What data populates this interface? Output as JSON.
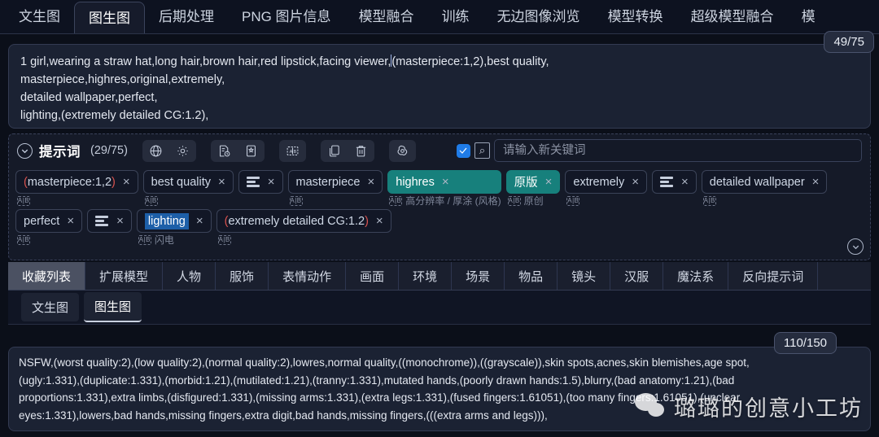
{
  "top_tabs": [
    {
      "label": "文生图",
      "active": false
    },
    {
      "label": "图生图",
      "active": true
    },
    {
      "label": "后期处理",
      "active": false
    },
    {
      "label": "PNG 图片信息",
      "active": false
    },
    {
      "label": "模型融合",
      "active": false
    },
    {
      "label": "训练",
      "active": false
    },
    {
      "label": "无边图像浏览",
      "active": false
    },
    {
      "label": "模型转换",
      "active": false
    },
    {
      "label": "超级模型融合",
      "active": false
    },
    {
      "label": "模",
      "active": false
    }
  ],
  "positive_prompt": {
    "lines": [
      "1 girl,wearing a straw hat,long hair,brown hair,red lipstick,facing viewer,(masterpiece:1,2),best quality,",
      "masterpiece,highres,original,extremely,",
      "detailed wallpaper,perfect,",
      "lighting,(extremely detailed CG:1.2),"
    ],
    "counter": "49/75"
  },
  "keyword_panel": {
    "title": "提示词",
    "count": "(29/75)",
    "toolbar_icons": [
      "globe-icon",
      "gear-icon",
      "history-document-icon",
      "bookmark-icon",
      "translate-ab-icon",
      "copy-icon",
      "trash-icon",
      "openai-spiral-icon"
    ],
    "add_keyword": {
      "checked": true,
      "placeholder": "请输入新关键词",
      "value": ""
    },
    "chips_row1": [
      {
        "text": "(masterpiece:1,2)",
        "paren": true,
        "style": "plain",
        "sub": ""
      },
      {
        "text": "best quality",
        "style": "plain",
        "sub": ""
      },
      {
        "text": "",
        "style": "sort",
        "sub": ""
      },
      {
        "text": "masterpiece",
        "style": "plain",
        "sub": ""
      },
      {
        "text": "highres",
        "style": "fill-teal",
        "sub": "高分辨率 / 厚涂 (风格)"
      },
      {
        "text": "原版",
        "style": "fill-teal",
        "sub": "原创"
      },
      {
        "text": "extremely",
        "style": "plain",
        "sub": ""
      },
      {
        "text": "",
        "style": "sort",
        "sub": ""
      },
      {
        "text": "detailed wallpaper",
        "style": "plain",
        "sub": ""
      }
    ],
    "chips_row2": [
      {
        "text": "perfect",
        "style": "plain",
        "sub": ""
      },
      {
        "text": "",
        "style": "sort",
        "sub": ""
      },
      {
        "text": "lighting",
        "style": "hl-blue",
        "sub": "闪电"
      },
      {
        "text": "(extremely detailed CG:1.2)",
        "paren": true,
        "style": "plain",
        "sub": ""
      }
    ]
  },
  "category_tabs": [
    {
      "label": "收藏列表",
      "active": true
    },
    {
      "label": "扩展模型",
      "active": false
    },
    {
      "label": "人物",
      "active": false
    },
    {
      "label": "服饰",
      "active": false
    },
    {
      "label": "表情动作",
      "active": false
    },
    {
      "label": "画面",
      "active": false
    },
    {
      "label": "环境",
      "active": false
    },
    {
      "label": "场景",
      "active": false
    },
    {
      "label": "物品",
      "active": false
    },
    {
      "label": "镜头",
      "active": false
    },
    {
      "label": "汉服",
      "active": false
    },
    {
      "label": "魔法系",
      "active": false
    },
    {
      "label": "反向提示词",
      "active": false
    }
  ],
  "sub_tabs": [
    {
      "label": "文生图",
      "active": false
    },
    {
      "label": "图生图",
      "active": true
    }
  ],
  "negative_prompt": {
    "lines": [
      "NSFW,(worst quality:2),(low quality:2),(normal quality:2),lowres,normal quality,((monochrome)),((grayscale)),skin spots,acnes,skin blemishes,age spot,",
      "(ugly:1.331),(duplicate:1.331),(morbid:1.21),(mutilated:1.21),(tranny:1.331),mutated hands,(poorly drawn hands:1.5),blurry,(bad anatomy:1.21),(bad",
      "proportions:1.331),extra limbs,(disfigured:1.331),(missing arms:1.331),(extra legs:1.331),(fused fingers:1.61051),(too many fingers:1.61051),(unclear",
      "eyes:1.331),lowers,bad hands,missing fingers,extra digit,bad hands,missing fingers,(((extra arms and legs))),"
    ],
    "counter": "110/150"
  },
  "watermark": {
    "text": "璐璐的创意小工坊",
    "logo": "wechat-icon"
  },
  "colors": {
    "accent_blue": "#1f7ce8",
    "accent_teal": "#17807c",
    "highlight_blue": "#1d5fa8",
    "paren_red": "#d9534f",
    "panel_bg": "#1b2233",
    "page_bg": "#0b0f19"
  }
}
